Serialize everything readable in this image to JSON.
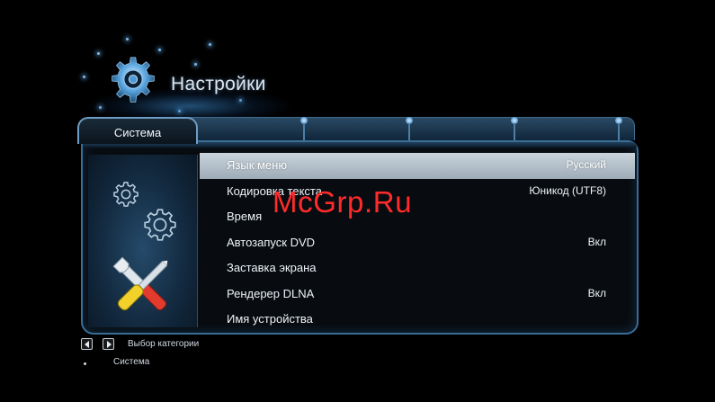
{
  "header": {
    "title": "Настройки",
    "icon": "gear-icon"
  },
  "tabs": [
    {
      "label": "Система",
      "active": true
    },
    {
      "label": "",
      "active": false
    },
    {
      "label": "",
      "active": false
    },
    {
      "label": "",
      "active": false
    },
    {
      "label": "",
      "active": false
    }
  ],
  "menu": {
    "items": [
      {
        "label": "Язык меню",
        "value": "Русский",
        "selected": true
      },
      {
        "label": "Кодировка текста",
        "value": "Юникод (UTF8)",
        "selected": false
      },
      {
        "label": "Время",
        "value": "",
        "selected": false
      },
      {
        "label": "Автозапуск DVD",
        "value": "Вкл",
        "selected": false
      },
      {
        "label": "Заставка экрана",
        "value": "",
        "selected": false
      },
      {
        "label": "Рендерер DLNA",
        "value": "Вкл",
        "selected": false
      },
      {
        "label": "Имя устройства",
        "value": "",
        "selected": false
      }
    ]
  },
  "hints": {
    "category_hint": "Выбор категории",
    "current_category": "Система"
  },
  "watermark": "McGrp.Ru",
  "colors": {
    "background": "#000000",
    "accent": "#3a6d94",
    "selection": "#b4c0ca",
    "watermark": "#ff2b2b"
  }
}
